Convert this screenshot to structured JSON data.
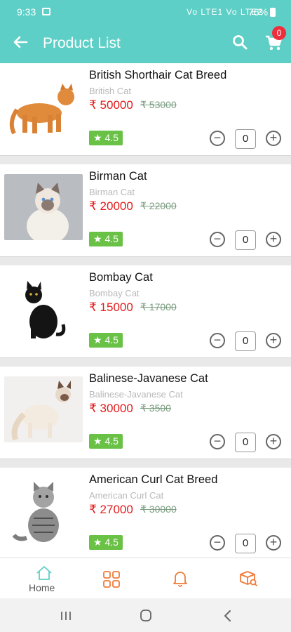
{
  "status_bar": {
    "time": "9:33",
    "network": "Vo LTE1 Vo LTE2",
    "battery": "76%"
  },
  "app_bar": {
    "title": "Product List",
    "cart_count": "0"
  },
  "products": [
    {
      "name": "British Shorthair Cat Breed",
      "subtitle": "British Cat",
      "price": "₹ 50000",
      "mrp": "₹ 53000",
      "rating": "★ 4.5",
      "qty": "0"
    },
    {
      "name": "Birman Cat",
      "subtitle": "Birman Cat",
      "price": "₹ 20000",
      "mrp": "₹ 22000",
      "rating": "★ 4.5",
      "qty": "0"
    },
    {
      "name": "Bombay Cat",
      "subtitle": "Bombay Cat",
      "price": "₹ 15000",
      "mrp": "₹ 17000",
      "rating": "★ 4.5",
      "qty": "0"
    },
    {
      "name": "Balinese-Javanese Cat",
      "subtitle": "Balinese-Javanese Cat",
      "price": "₹ 30000",
      "mrp": "₹ 3500",
      "rating": "★ 4.5",
      "qty": "0"
    },
    {
      "name": "American Curl Cat Breed",
      "subtitle": "American Curl Cat",
      "price": "₹ 27000",
      "mrp": "₹ 30000",
      "rating": "★ 4.5",
      "qty": "0"
    }
  ],
  "bottom_nav": {
    "home_label": "Home",
    "icons": [
      "home-icon",
      "grid-icon",
      "bell-icon",
      "box-search-icon"
    ]
  },
  "colors": {
    "primary": "#5ecfc6",
    "price": "#e21b1b",
    "rating": "#69c146",
    "nav_accent": "#f07a3a",
    "badge": "#ef2d3c"
  }
}
